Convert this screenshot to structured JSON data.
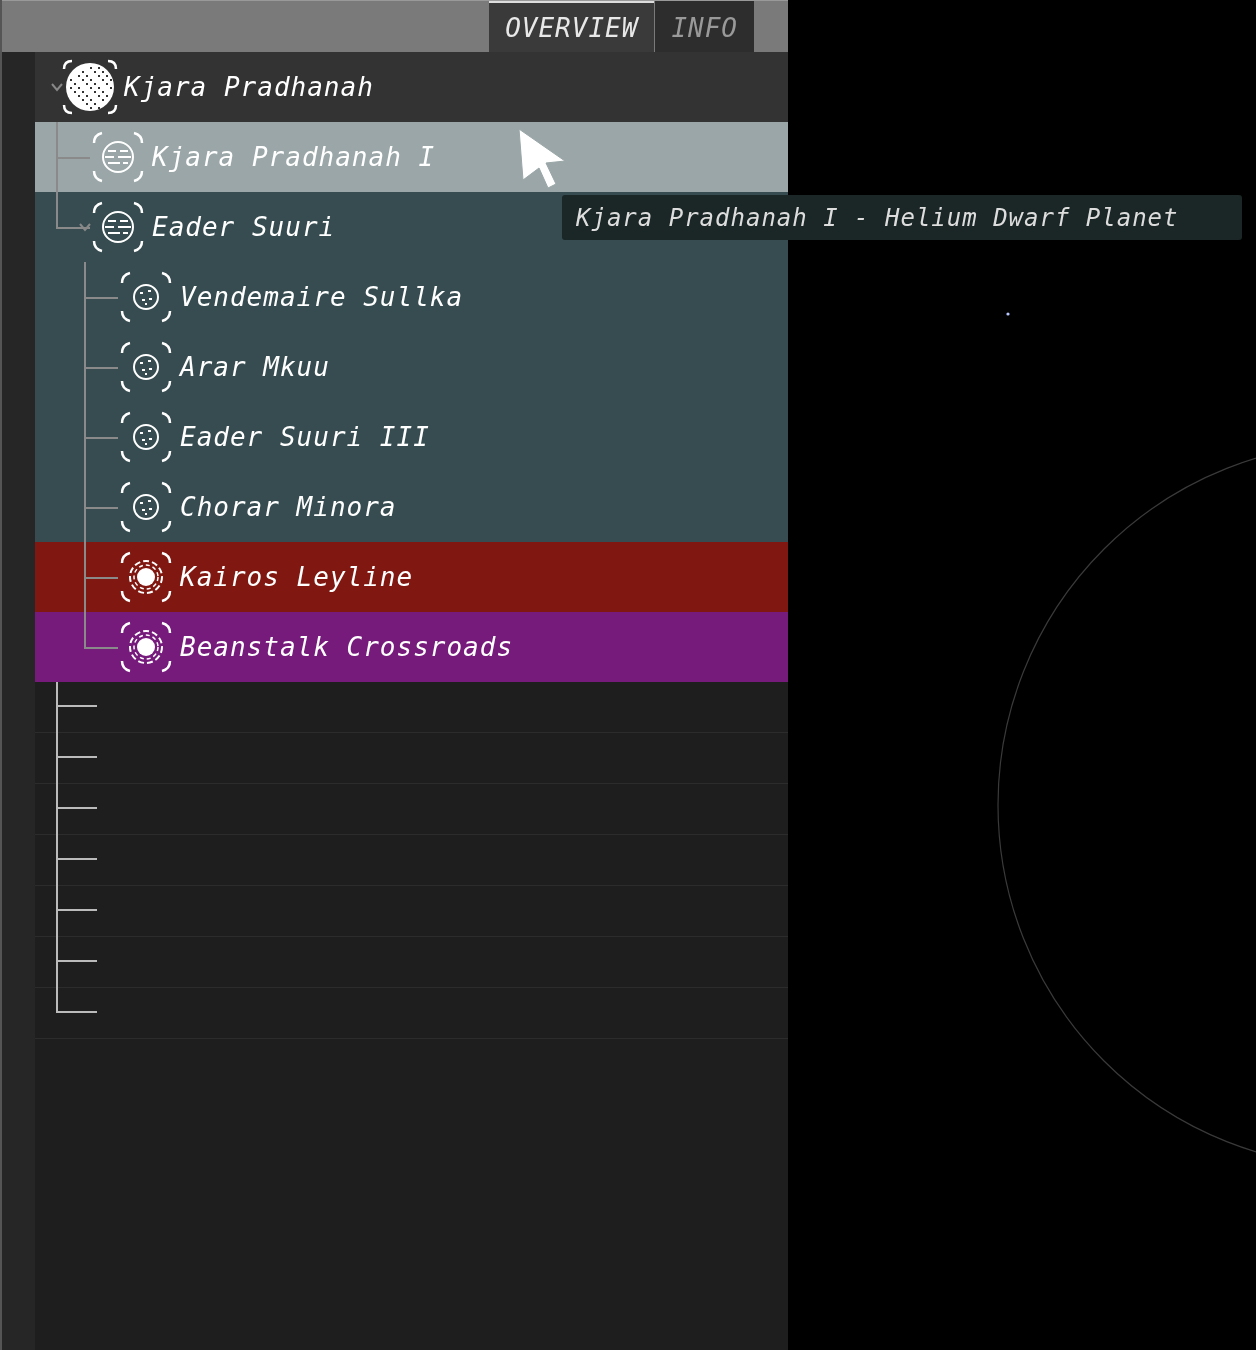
{
  "tabs": [
    {
      "label": "OVERVIEW",
      "selected": true
    },
    {
      "label": "INFO",
      "selected": false
    }
  ],
  "tree": {
    "label": "Kjara Pradhanah",
    "kind": "system",
    "color": "#333333",
    "expanded": true,
    "children": [
      {
        "label": "Kjara Pradhanah I",
        "kind": "planet",
        "color": "#9aa6a7"
      },
      {
        "label": "Eader Suuri",
        "kind": "planet",
        "color": "#364c50",
        "expanded": true,
        "children": [
          {
            "label": "Vendemaire Sullka",
            "kind": "moon",
            "color": "#364c50"
          },
          {
            "label": "Arar Mkuu",
            "kind": "moon",
            "color": "#364c50"
          },
          {
            "label": "Eader Suuri III",
            "kind": "moon",
            "color": "#364c50"
          },
          {
            "label": "Chorar Minora",
            "kind": "moon",
            "color": "#364c50"
          },
          {
            "label": "Kairos Leyline",
            "kind": "anomaly",
            "color": "#801811"
          },
          {
            "label": "Beanstalk Crossroads",
            "kind": "anomaly",
            "color": "#761a7c"
          }
        ]
      }
    ]
  },
  "tooltip": "Kjara Pradhanah I - Helium Dwarf Planet"
}
